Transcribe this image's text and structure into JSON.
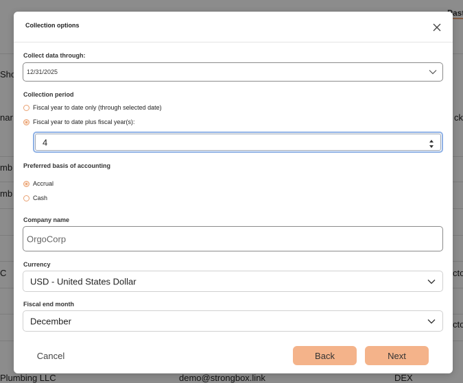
{
  "background": {
    "tab_label": "Past",
    "row_fragments": [
      "Sho",
      "nar",
      "mb P",
      "mb P",
      "C",
      "ck",
      "ctor",
      "ctor"
    ],
    "bottom_row": {
      "company": "Plumbing LLC",
      "email": "demo@strongbox.link",
      "code": "DEX"
    }
  },
  "modal": {
    "title": "Collection options",
    "collect_through": {
      "label": "Collect data through:",
      "value": "12/31/2025"
    },
    "collection_period": {
      "label": "Collection period",
      "options": [
        {
          "label": "Fiscal year to date only (through selected date)",
          "selected": false
        },
        {
          "label": "Fiscal year to date plus fiscal year(s):",
          "selected": true
        }
      ],
      "years_value": "4"
    },
    "accounting_basis": {
      "label": "Preferred basis of accounting",
      "options": [
        {
          "label": "Accrual",
          "selected": true
        },
        {
          "label": "Cash",
          "selected": false
        }
      ]
    },
    "company_name": {
      "label": "Company name",
      "value": "OrgoCorp"
    },
    "currency": {
      "label": "Currency",
      "value": "USD - United States Dollar"
    },
    "fiscal_end_month": {
      "label": "Fiscal end month",
      "value": "December"
    },
    "buttons": {
      "cancel": "Cancel",
      "back": "Back",
      "next": "Next"
    }
  },
  "colors": {
    "accent": "#f4b38a",
    "radio": "#e9a070",
    "focus": "#8fb1e5"
  }
}
